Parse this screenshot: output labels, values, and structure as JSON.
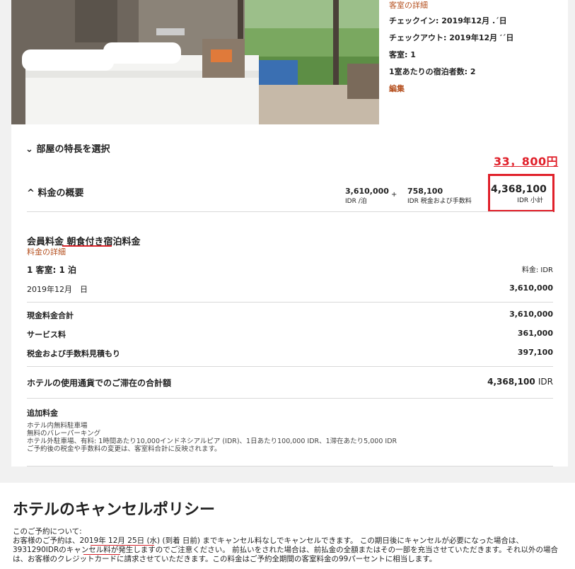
{
  "stay_details": {
    "heading": "客室の詳細",
    "checkin": "チェックイン: 2019年12月 .´日",
    "checkout": "チェックアウト: 2019年12月 ′´日",
    "rooms": "客室: 1",
    "guests": "1室あたりの宿泊者数: 2",
    "edit": "編集"
  },
  "room_features_toggle": "部屋の特長を選択",
  "handwritten_note": "33，800円",
  "price_summary": {
    "toggle": "料金の概要",
    "per_night_value": "3,610,000",
    "per_night_label": "IDR /泊",
    "plus": "+",
    "tax_value": "758,100",
    "tax_label": "IDR 税金および手数料",
    "subtotal_value": "4,368,100",
    "subtotal_label": "IDR 小計"
  },
  "rate": {
    "name": "会員料金 朝食付き宿泊料金",
    "details_link": "料金の詳細",
    "rooms_nights": "1 客室: 1 泊",
    "rate_currency": "料金: IDR",
    "date": "2019年12月　日",
    "date_amount": "3,610,000",
    "lines": [
      {
        "label": "現金料金合計",
        "amount": "3,610,000"
      },
      {
        "label": "サービス料",
        "amount": "361,000"
      },
      {
        "label": "税金および手数料見積もり",
        "amount": "397,100"
      }
    ],
    "total_label": "ホテルの使用通貨でのご滞在の合計額",
    "total_amount": "4,368,100",
    "total_currency": "IDR"
  },
  "additional": {
    "heading": "追加料金",
    "lines": [
      "ホテル内無料駐車場",
      "無料のバレーパーキング",
      "ホテル外駐車場、有料: 1時間あたり10,000インドネシアルピア (IDR)、1日あたり100,000 IDR、1滞在あたり5,000 IDR",
      "ご予約後の税金や手数料の変更は、客室料合計に反映されます。"
    ]
  },
  "policy": {
    "title": "ホテルのキャンセルポリシー",
    "subtitle": "このご予約について:",
    "lines": [
      "お客様のご予約は、2019年 12月 25日 (水) (到着 日前) までキャンセル料なしでキャンセルできます。 この期日後にキャンセルが必要になった場合は、",
      "3931290IDRのキャンセル料が発生しますのでご注意ください。 前払いをされた場合は、前払金の全額またはその一部を充当させていただきます。それ以外の場合",
      "は、お客様のクレジットカードに請求させていただきます。この料金はご予約全期間の客室料金の99パーセントに相当します。"
    ]
  },
  "colors": {
    "accent_link": "#b5501f",
    "annotation_red": "#e0202a"
  }
}
